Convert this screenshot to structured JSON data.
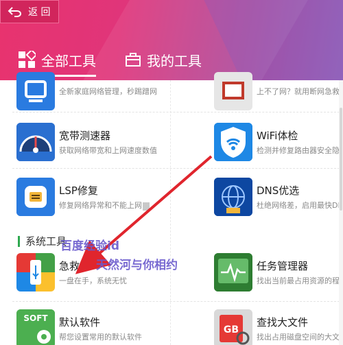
{
  "header": {
    "back_label": "返 回",
    "tabs": [
      {
        "label": "全部工具",
        "active": true
      },
      {
        "label": "我的工具",
        "active": false
      }
    ]
  },
  "partial_top": [
    {
      "title": "",
      "desc": "全新家庭网络管理，秒踢蹭网"
    },
    {
      "title": "",
      "desc": "上不了网？就用断网急救"
    }
  ],
  "tools": [
    {
      "title": "宽带测速器",
      "desc": "获取网络带宽和上网速度数值"
    },
    {
      "title": "WiFi体检",
      "desc": "检测并修复路由器安全隐"
    },
    {
      "title": "LSP修复",
      "desc": "修复网络异常和不能上网"
    },
    {
      "title": "DNS优选",
      "desc": "杜绝网络差，启用最快DNS"
    }
  ],
  "section": {
    "label": "系统工具"
  },
  "system_tools": [
    {
      "title": "急救盘",
      "desc": "一盘在手，系统无忧"
    },
    {
      "title": "任务管理器",
      "desc": "找出当前最占用资源的程序"
    },
    {
      "title": "默认软件",
      "desc": "帮您设置常用的默认软件"
    },
    {
      "title": "查找大文件",
      "desc": "找出占用磁盘空间的大文件"
    }
  ],
  "icons": {
    "soft_label": "SOFT",
    "gb_label": "GB"
  },
  "watermarks": {
    "line1": "百度经验id",
    "line2": "天然河与你相约"
  },
  "colors": {
    "header_pink": "#e8336e",
    "header_purple": "#9a66b8",
    "section_bar": "#2ea84f",
    "annotation_arrow": "#e0252d"
  }
}
